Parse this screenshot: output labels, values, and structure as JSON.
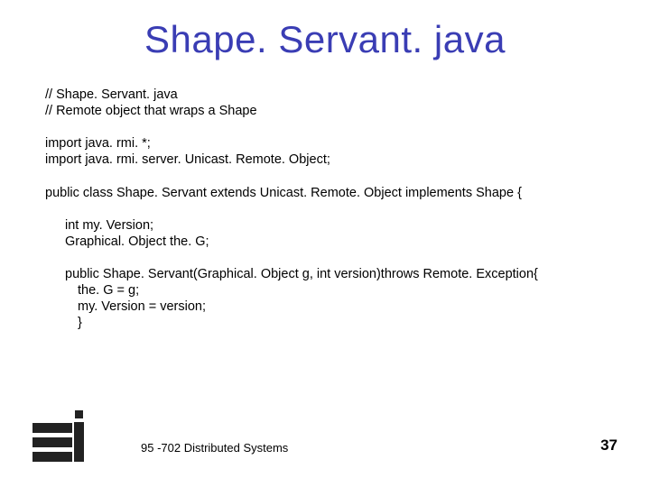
{
  "title": "Shape. Servant. java",
  "code": {
    "c1": "// Shape. Servant. java",
    "c2": "// Remote object that wraps a Shape",
    "c3": "import java. rmi. *;",
    "c4": "import java. rmi. server. Unicast. Remote. Object;",
    "c5": "public class Shape. Servant extends Unicast. Remote. Object implements Shape {",
    "c6": "int my. Version;",
    "c7": "Graphical. Object the. G;",
    "c8": "public Shape. Servant(Graphical. Object g, int version)throws Remote. Exception{",
    "c9": "the. G = g;",
    "c10": "my. Version = version;",
    "c11": "}"
  },
  "footer": "95 -702 Distributed Systems",
  "page": "37"
}
